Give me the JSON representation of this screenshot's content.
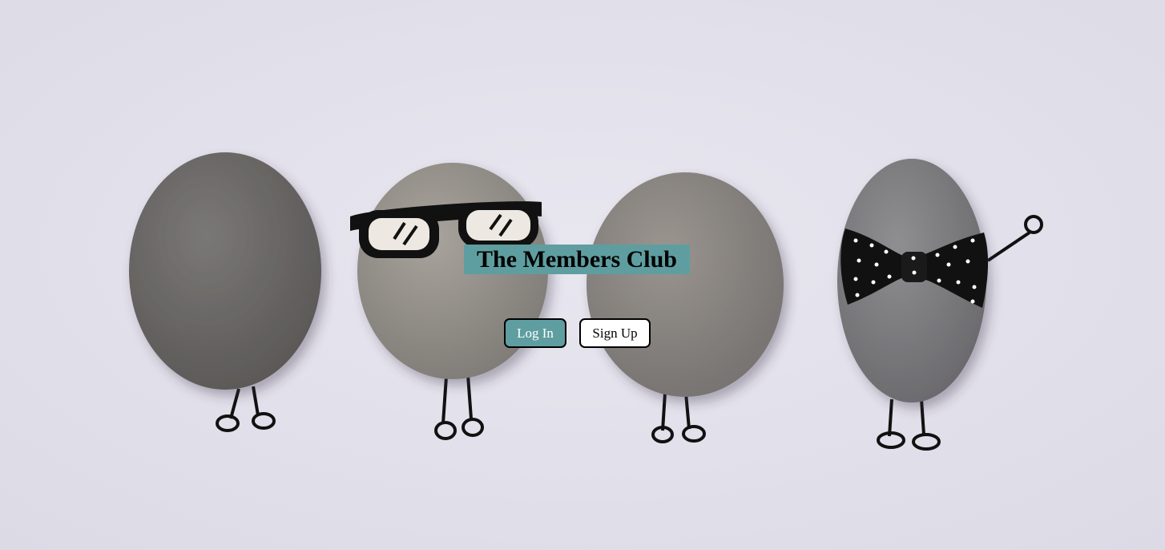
{
  "page": {
    "title": "The Members Club",
    "background_color": "#e2e0ea",
    "accent_color": "#5f9ea0"
  },
  "hero_image": {
    "description_icon": "pebble-people-illustration"
  },
  "actions": {
    "login_label": "Log In",
    "signup_label": "Sign Up"
  }
}
